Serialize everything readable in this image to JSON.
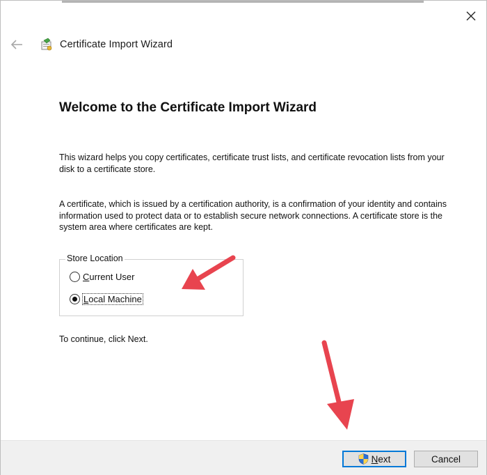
{
  "window": {
    "title": "Certificate Import Wizard",
    "close_icon": "close-icon",
    "back_icon": "back-arrow-icon",
    "wizard_icon": "certificate-wizard-icon"
  },
  "main": {
    "heading": "Welcome to the Certificate Import Wizard",
    "paragraph1": "This wizard helps you copy certificates, certificate trust lists, and certificate revocation lists from your disk to a certificate store.",
    "paragraph2": "A certificate, which is issued by a certification authority, is a confirmation of your identity and contains information used to protect data or to establish secure network connections. A certificate store is the system area where certificates are kept.",
    "store_location": {
      "legend": "Store Location",
      "options": [
        {
          "label": "Current User",
          "accel": "C",
          "rest": "urrent User",
          "checked": false
        },
        {
          "label": "Local Machine",
          "accel": "L",
          "rest": "ocal Machine",
          "checked": true
        }
      ]
    },
    "continue_text": "To continue, click Next."
  },
  "footer": {
    "next": {
      "label": "Next",
      "accel": "N",
      "rest": "ext",
      "icon": "uac-shield-icon"
    },
    "cancel_label": "Cancel"
  },
  "annotations": {
    "arrow_color": "#e8444f",
    "arrows": [
      "pointing-to-local-machine",
      "pointing-to-next-button"
    ]
  }
}
